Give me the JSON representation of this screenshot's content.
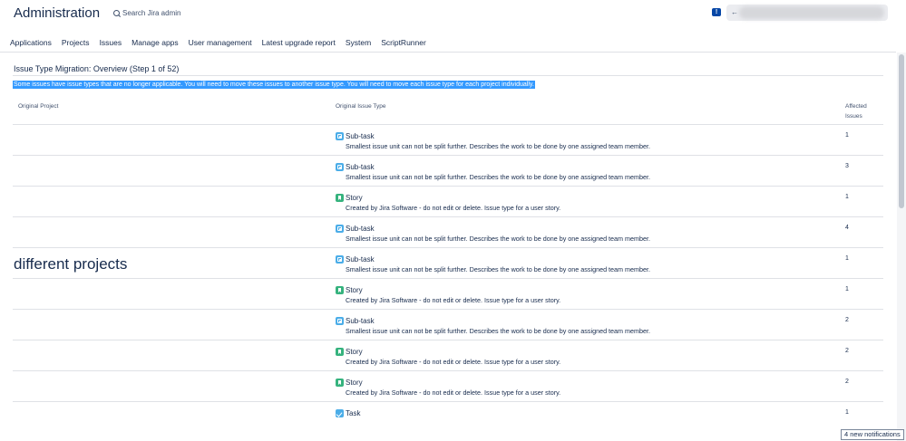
{
  "header": {
    "title": "Administration",
    "search_placeholder": "Search Jira admin",
    "feedback_icon": "feedback-icon",
    "user_arrow": "←"
  },
  "nav": {
    "items": [
      "Applications",
      "Projects",
      "Issues",
      "Manage apps",
      "User management",
      "Latest upgrade report",
      "System",
      "ScriptRunner"
    ]
  },
  "page": {
    "title": "Issue Type Migration: Overview (Step 1 of 52)",
    "info": "Some issues have issue types that are no longer applicable. You will need to move these issues to another issue type. You will need to move each issue type for each project individually."
  },
  "table": {
    "headers": {
      "project": "Original Project",
      "type": "Original Issue Type",
      "affected_line1": "Affected",
      "affected_line2": "Issues"
    },
    "rows": [
      {
        "icon": "subtask",
        "name": "Sub-task",
        "desc": "Smallest issue unit can not be split further. Describes the work to be done by one assigned team member.",
        "affected": "1",
        "project": ""
      },
      {
        "icon": "subtask",
        "name": "Sub-task",
        "desc": "Smallest issue unit can not be split further. Describes the work to be done by one assigned team member.",
        "affected": "3",
        "project": ""
      },
      {
        "icon": "story",
        "name": "Story",
        "desc": "Created by Jira Software - do not edit or delete. Issue type for a user story.",
        "affected": "1",
        "project": ""
      },
      {
        "icon": "subtask",
        "name": "Sub-task",
        "desc": "Smallest issue unit can not be split further. Describes the work to be done by one assigned team member.",
        "affected": "4",
        "project": ""
      },
      {
        "icon": "subtask",
        "name": "Sub-task",
        "desc": "Smallest issue unit can not be split further. Describes the work to be done by one assigned team member.",
        "affected": "1",
        "project": "different projects"
      },
      {
        "icon": "story",
        "name": "Story",
        "desc": "Created by Jira Software - do not edit or delete. Issue type for a user story.",
        "affected": "1",
        "project": ""
      },
      {
        "icon": "subtask",
        "name": "Sub-task",
        "desc": "Smallest issue unit can not be split further. Describes the work to be done by one assigned team member.",
        "affected": "2",
        "project": ""
      },
      {
        "icon": "story",
        "name": "Story",
        "desc": "Created by Jira Software - do not edit or delete. Issue type for a user story.",
        "affected": "2",
        "project": ""
      },
      {
        "icon": "story",
        "name": "Story",
        "desc": "Created by Jira Software - do not edit or delete. Issue type for a user story.",
        "affected": "2",
        "project": ""
      },
      {
        "icon": "task",
        "name": "Task",
        "desc": "",
        "affected": "1",
        "project": ""
      }
    ]
  },
  "notifications": "4 new notifications",
  "colors": {
    "accent": "#0052cc",
    "selection": "#3399ff",
    "subtask": "#4bade8",
    "story": "#36b37e",
    "task": "#4bade8"
  }
}
